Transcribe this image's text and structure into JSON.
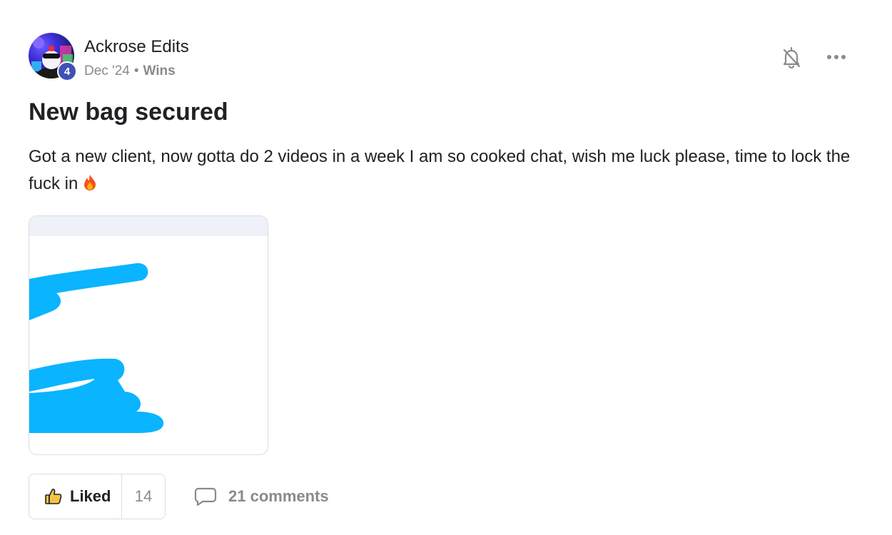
{
  "post": {
    "author": {
      "name": "Ackrose Edits",
      "level": "4",
      "avatar_icon": "avatar-image"
    },
    "meta": {
      "date": "Dec '24",
      "separator": "•",
      "category": "Wins"
    },
    "title": "New bag secured",
    "body": "Got a new client, now gotta do 2 videos in a week I am so cooked chat, wish me luck please, time to lock the fuck in",
    "body_emoji": "fire-icon",
    "actions": {
      "bell_icon": "bell-off-icon",
      "more_icon": "more-options-icon"
    },
    "attachment": {
      "description_icon": "redacted-screenshot-thumbnail"
    },
    "footer": {
      "like_label": "Liked",
      "like_count": "14",
      "comments_label": "21 comments"
    }
  },
  "colors": {
    "level_badge": "#3f51b5",
    "scribble": "#0ab4ff",
    "muted_text": "#8a8a8a",
    "border": "#dcdde2"
  }
}
